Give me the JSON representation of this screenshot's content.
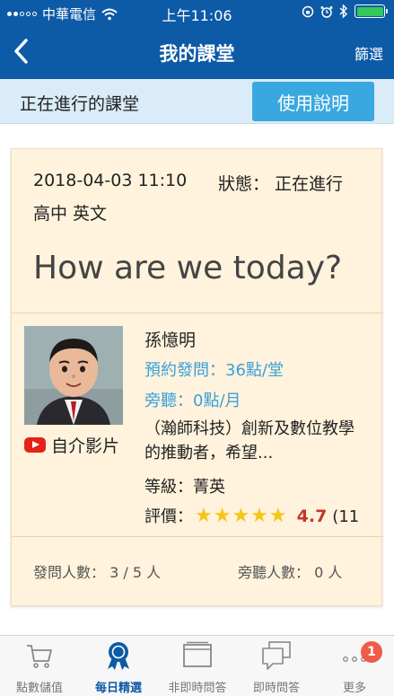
{
  "status_bar": {
    "carrier": "中華電信",
    "time": "上午11:06"
  },
  "nav": {
    "title": "我的課堂",
    "filter_label": "篩選"
  },
  "section": {
    "label": "正在進行的課堂",
    "help_button": "使用說明"
  },
  "class_card": {
    "datetime": "2018-04-03 11:10",
    "status": "狀態： 正在進行",
    "course": "高中 英文",
    "topic": "How are we today?",
    "teacher": {
      "name": "孫憶明",
      "booking": "預約發問：36點/堂",
      "audit": "旁聽：0點/月",
      "description": "（瀚師科技）創新及數位教學的推動者，希望...",
      "level": "等級：菁英",
      "rating_label": "評價：",
      "rating_stars": 5,
      "rating_score": "4.7",
      "rating_count": "(11",
      "video_label": "自介影片"
    },
    "asks": "發問人數： 3 / 5 人",
    "listeners": "旁聽人數： 0 人"
  },
  "tab_bar": {
    "tabs": [
      {
        "label": "點數儲值",
        "icon": "cart-icon"
      },
      {
        "label": "每日精選",
        "icon": "ribbon-icon",
        "active": true
      },
      {
        "label": "非即時問答",
        "icon": "tray-icon"
      },
      {
        "label": "即時問答",
        "icon": "chat-icon"
      },
      {
        "label": "更多",
        "icon": "more-icon",
        "badge": "1"
      }
    ]
  },
  "colors": {
    "nav_blue": "#0d5aa7",
    "section_bg": "#d9ecf8",
    "help_button": "#3aa8e0",
    "card_bg": "#fff3dd",
    "accent_blue_text": "#3aa0d8",
    "star": "#f5c518",
    "score_red": "#c0392b",
    "badge_red": "#ee5b4a"
  }
}
